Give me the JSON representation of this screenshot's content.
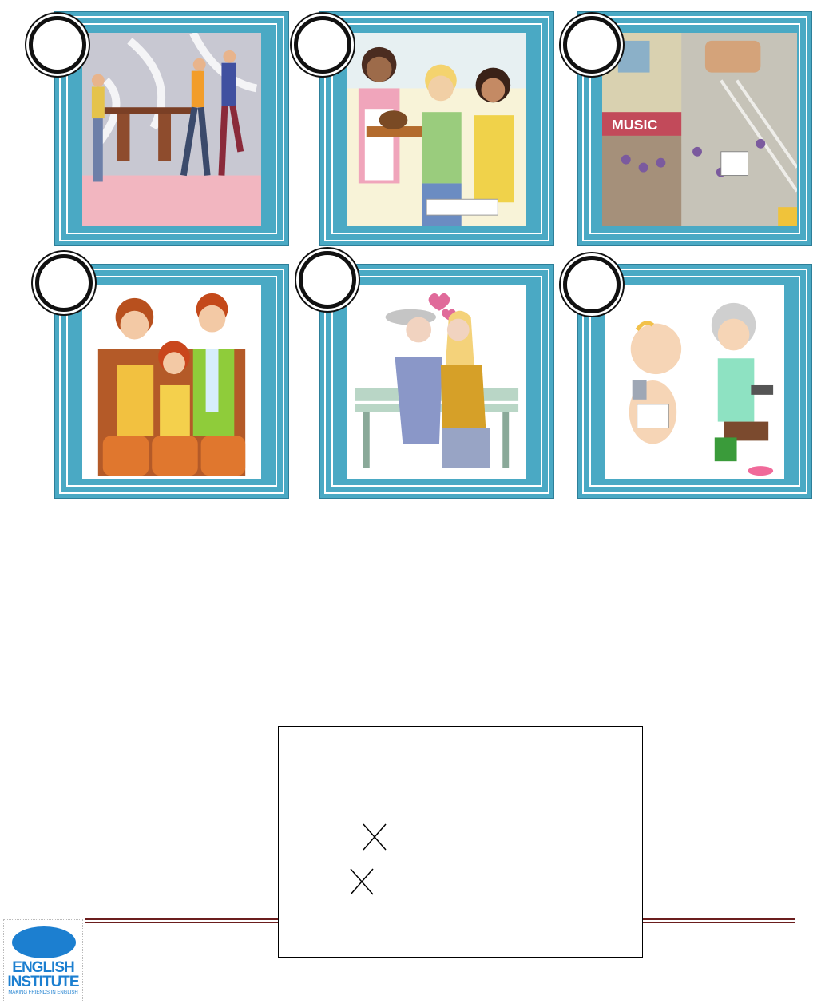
{
  "cards": [
    {
      "icon": "people-carrying-desk-icon"
    },
    {
      "icon": "students-and-waitress-with-cake-icon"
    },
    {
      "icon": "busy-street-music-shop-icon"
    },
    {
      "icon": "family-at-cinema-icon"
    },
    {
      "icon": "couple-on-bench-icon"
    },
    {
      "icon": "baby-and-grandmother-icon"
    }
  ],
  "answer_box": {
    "marks": [
      "cross-mark",
      "cross-mark"
    ]
  },
  "logo": {
    "line1": "ENGLISH",
    "line2": "INSTITUTE",
    "tagline": "MAKING FRIENDS IN ENGLISH"
  },
  "colors": {
    "card_frame": "#4aa9c4",
    "footer_line": "#6b1e1e",
    "logo_blue": "#1c7fd0"
  }
}
